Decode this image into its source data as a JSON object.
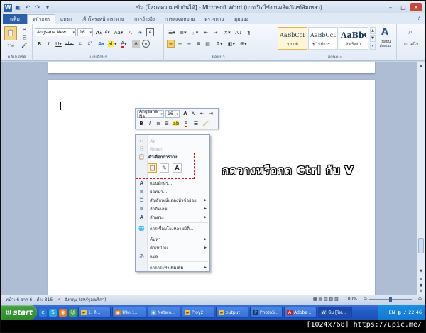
{
  "window": {
    "title": "ข้ม [โหมดความเข้ากันได้] - Microsoft Word (การเปิดใช้งานผลิตภัณฑ์ล้มเหลว)"
  },
  "ribbon_tabs": {
    "file": "แฟ้ม",
    "items": [
      "หน้าแรก",
      "แทรก",
      "เค้าโครงหน้ากระดาษ",
      "การอ้างอิง",
      "การส่งจดหมาย",
      "ตรวจทาน",
      "มุมมอง"
    ],
    "active_index": 0
  },
  "ribbon": {
    "clipboard": {
      "paste_label": "วาง",
      "group_label": "คลิปบอร์ด"
    },
    "font": {
      "font_name": "Angsana New",
      "font_size": "16",
      "group_label": "แบบอักษร"
    },
    "paragraph": {
      "group_label": "ย่อหน้า"
    },
    "styles": {
      "group_label": "ลักษณะ",
      "items": [
        {
          "sample": "AaBbCcDc",
          "name": "¶ ปกติ",
          "selected": true
        },
        {
          "sample": "AaBbCcDc",
          "name": "¶ ไม่มีการ...",
          "selected": false
        },
        {
          "sample": "AaBbC",
          "name": "หัวเรื่อง 1",
          "selected": false
        }
      ],
      "change_styles": "เปลี่ยน ลักษณะ",
      "editing": "การ แก้ไข"
    }
  },
  "mini_toolbar": {
    "font_name": "Angsana Ne",
    "font_size": "16"
  },
  "context_menu": {
    "cut": "ตัด",
    "copy": "คัดลอก",
    "paste_options": "ตัวเลือกการวาง:",
    "items": [
      {
        "label": "แบบอักษร...",
        "icon": "font-icon",
        "submenu": false
      },
      {
        "label": "ย่อหน้า...",
        "icon": "paragraph-icon",
        "submenu": false
      },
      {
        "label": "สัญลักษณ์แสดงหัวข้อย่อย",
        "icon": "bullets-icon",
        "submenu": true
      },
      {
        "label": "ลำดับเลข",
        "icon": "numbering-icon",
        "submenu": true
      },
      {
        "label": "ลักษณะ",
        "icon": "styles-icon",
        "submenu": true
      },
      {
        "label": "การเชื่อมโยงหลายมิติ...",
        "icon": "hyperlink-icon",
        "submenu": false
      },
      {
        "label": "ค้นหา",
        "icon": "",
        "submenu": true
      },
      {
        "label": "คำเหมือน",
        "icon": "",
        "submenu": true
      },
      {
        "label": "แปล",
        "icon": "translate-icon",
        "submenu": false
      },
      {
        "label": "การกระทำเพิ่มเติม",
        "icon": "",
        "submenu": true
      }
    ]
  },
  "annotation": "กดวางหรือกด Ctrl กับ V",
  "status_bar": {
    "page": "หน้า: 6 จาก 6",
    "words": "คำ: 816",
    "language": "อังกฤษ (สหรัฐอเมริกา)",
    "zoom": "100%"
  },
  "taskbar": {
    "start": "start",
    "tasks": [
      {
        "label": "1. ทิ...",
        "active": false
      },
      {
        "label": "พิษิด 1...",
        "active": false
      },
      {
        "label": "Netwo...",
        "active": false
      },
      {
        "label": "Ploy2",
        "active": false
      },
      {
        "label": "output",
        "active": false
      },
      {
        "label": "PhotoS...",
        "active": false
      },
      {
        "label": "Adobe ...",
        "active": false
      },
      {
        "label": "ข้ม [โห...",
        "active": true
      }
    ],
    "lang": "EN",
    "clock": "22:46"
  },
  "watermark": "[1024x768] https://upic.me/",
  "colors": {
    "word_blue": "#2b5fa8",
    "taskbar_blue": "#245dc8",
    "start_green": "#2e8a2e",
    "paste_frame_red": "#dd1111"
  }
}
